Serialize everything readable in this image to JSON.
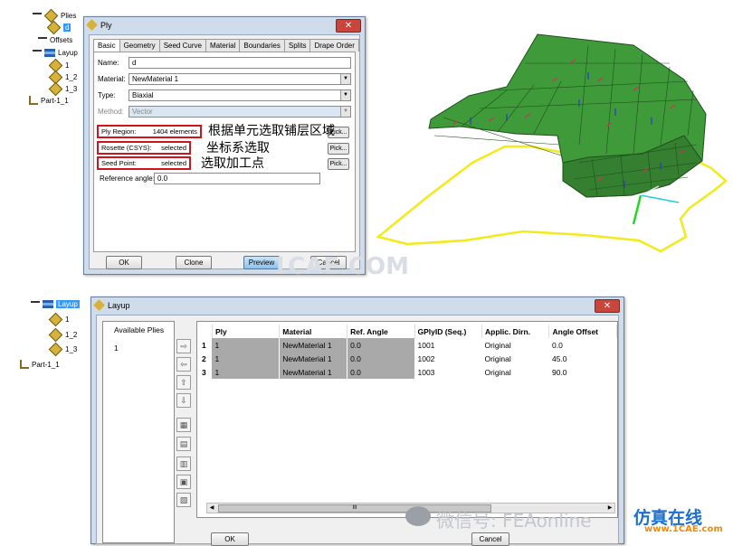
{
  "tree_top": {
    "plies_label": "Plies",
    "ply_item": "d",
    "offsets_label": "Offsets",
    "layup_label": "Layup",
    "layup_items": [
      "1",
      "1_2",
      "1_3"
    ],
    "part_label": "Part-1_1"
  },
  "ply_dialog": {
    "title": "Ply",
    "close_symbol": "✕",
    "tabs": [
      "Basic",
      "Geometry",
      "Seed Curve",
      "Material",
      "Boundaries",
      "Splits",
      "Drape Order"
    ],
    "name_label": "Name:",
    "name_value": "d",
    "material_label": "Material:",
    "material_value": "NewMaterial 1",
    "type_label": "Type:",
    "type_value": "Biaxial",
    "method_label": "Method:",
    "method_value": "Vector",
    "ply_region_label": "Ply Region:",
    "ply_region_value": "1404 elements",
    "rosette_label": "Rosette (CSYS):",
    "rosette_value": "selected",
    "seed_label": "Seed Point:",
    "seed_value": "selected",
    "pick_label": "Pick...",
    "ref_angle_label": "Reference angle:",
    "ref_angle_value": "0.0",
    "ok_label": "OK",
    "clone_label": "Clone",
    "preview_label": "Preview",
    "cancel_label": "Cancel"
  },
  "annotations": {
    "line1": "根据单元选取铺层区域",
    "line2": "坐标系选取",
    "line3": "选取加工点"
  },
  "tree_bottom": {
    "layup_label": "Layup",
    "items": [
      "1",
      "1_2",
      "1_3"
    ],
    "part_label": "Part-1_1"
  },
  "layup_dialog": {
    "title": "Layup",
    "close_symbol": "✕",
    "available_label": "Available Plies",
    "available_items": [
      "1"
    ],
    "columns": [
      "Ply",
      "Material",
      "Ref. Angle",
      "GPlyID (Seq.)",
      "Applic. Dirn.",
      "Angle Offset"
    ],
    "rows": [
      {
        "n": "1",
        "ply": "1",
        "material": "NewMaterial 1",
        "ref": "0.0",
        "gply": "1001",
        "dirn": "Original",
        "offset": "0.0"
      },
      {
        "n": "2",
        "ply": "1",
        "material": "NewMaterial 1",
        "ref": "0.0",
        "gply": "1002",
        "dirn": "Original",
        "offset": "45.0"
      },
      {
        "n": "3",
        "ply": "1",
        "material": "NewMaterial 1",
        "ref": "0.0",
        "gply": "1003",
        "dirn": "Original",
        "offset": "90.0"
      }
    ],
    "scroll_mark": "III",
    "ok_label": "OK",
    "cancel_label": "Cancel"
  },
  "watermarks": {
    "center": "1CAE.COM",
    "wechat": "微信号: FEAonline",
    "brand": "仿真在线",
    "url": "www.1CAE.com"
  },
  "colors": {
    "mesh_green": "#3f9a3a",
    "boundary_yellow": "#f2ea1a",
    "highlight_red": "#d0141a",
    "selection_blue": "#3399ff"
  }
}
